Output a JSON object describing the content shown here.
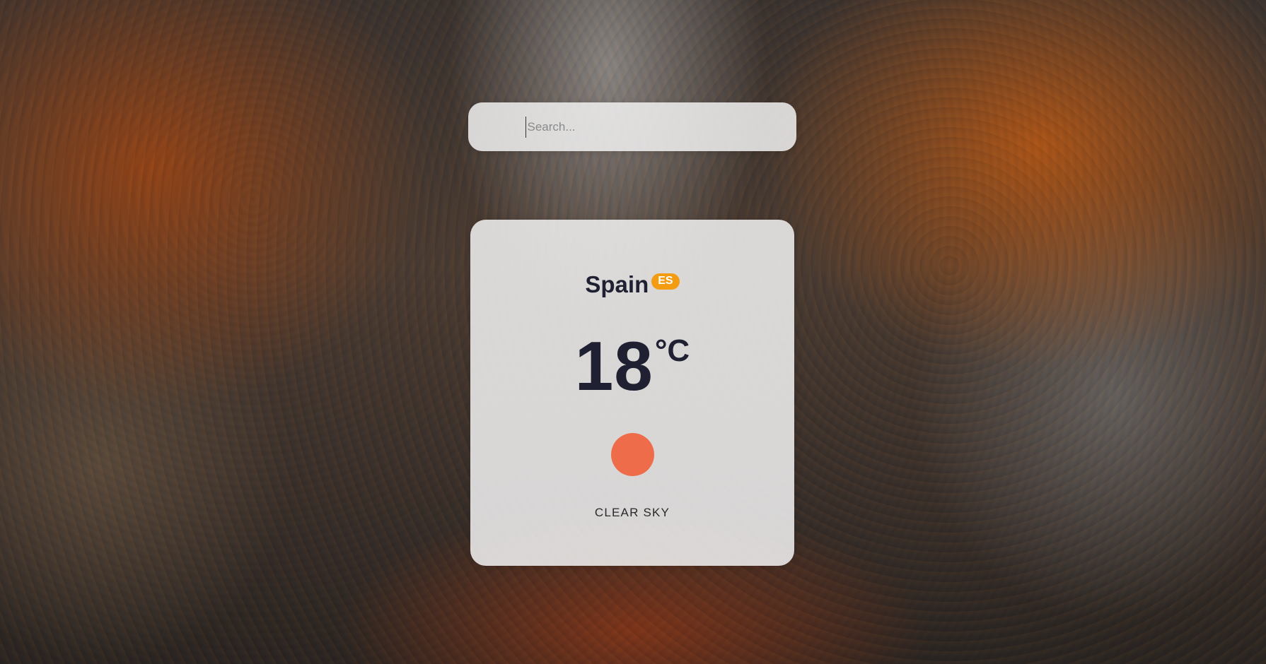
{
  "search": {
    "placeholder": "Search...",
    "value": ""
  },
  "weather": {
    "city": "Spain",
    "country_code": "ES",
    "temperature": "18",
    "unit": "°C",
    "description": "CLEAR SKY",
    "icon": "sun-icon"
  },
  "colors": {
    "badge": "#f39c12",
    "sun": "#ef6c4a",
    "text_dark": "#1f2133"
  }
}
